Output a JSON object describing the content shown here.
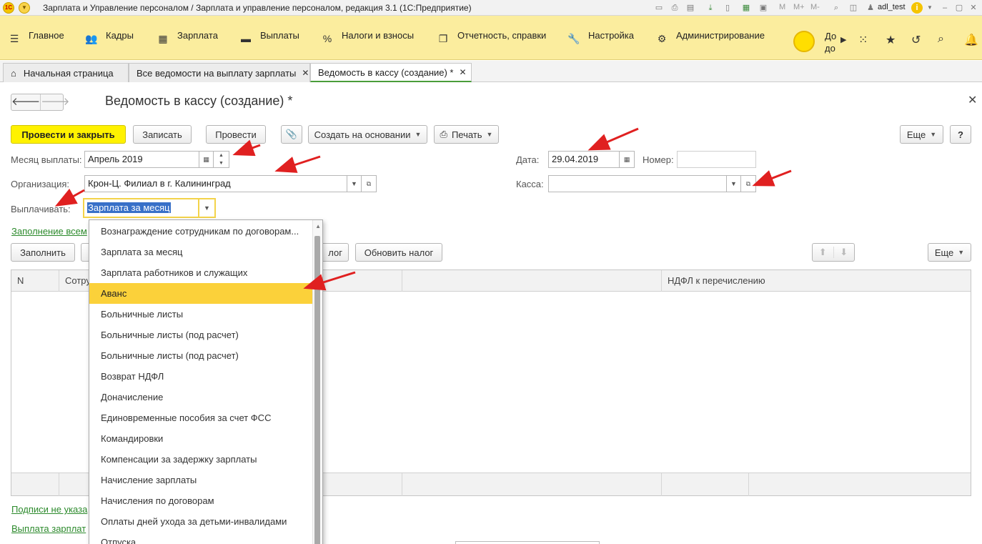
{
  "window": {
    "title": "Зарплата и Управление персоналом / Зарплата и управление персоналом, редакция 3.1  (1С:Предприятие)",
    "user": "adl_test",
    "m_buttons": [
      "M",
      "M+",
      "M-"
    ]
  },
  "menu": {
    "items": [
      {
        "label": "Главное",
        "icon": "hamburger-icon"
      },
      {
        "label": "Кадры",
        "icon": "people-icon"
      },
      {
        "label": "Зарплата",
        "icon": "calculator-icon"
      },
      {
        "label": "Выплаты",
        "icon": "wallet-icon"
      },
      {
        "label": "Налоги и взносы",
        "icon": "percent-icon"
      },
      {
        "label": "Отчетность, справки",
        "icon": "reports-icon"
      },
      {
        "label": "Настройка",
        "icon": "wrench-icon"
      },
      {
        "label": "Администрирование",
        "icon": "gear-icon"
      }
    ],
    "truncated_top": "До",
    "truncated_bottom": "до"
  },
  "tabs": [
    {
      "label": "Начальная страница"
    },
    {
      "label": "Все ведомости на выплату зарплаты"
    },
    {
      "label": "Ведомость в кассу (создание) *"
    }
  ],
  "form": {
    "title": "Ведомость в кассу (создание) *",
    "buttons": {
      "post_close": "Провести и закрыть",
      "save": "Записать",
      "post": "Провести",
      "create_based": "Создать на основании",
      "print": "Печать",
      "more": "Еще",
      "help": "?"
    },
    "month_label": "Месяц выплаты:",
    "month_value": "Апрель 2019",
    "date_label": "Дата:",
    "date_value": "29.04.2019",
    "number_label": "Номер:",
    "number_value": "",
    "org_label": "Организация:",
    "org_value": "Крон-Ц. Филиал в г. Калининград",
    "cash_label": "Касса:",
    "cash_value": "",
    "pay_label": "Выплачивать:",
    "pay_value": "Зарплата за месяц",
    "fill_link": "Заполнение всем",
    "fill_btn": "Заполнить",
    "tax_btn_partial": "лог",
    "update_tax_btn": "Обновить налог",
    "more2": "Еще",
    "signatures_link": "Подписи не указа",
    "payout_link": "Выплата зарплат"
  },
  "table": {
    "columns": [
      "N",
      "Сотру",
      "",
      "НДФЛ к перечислению"
    ]
  },
  "dropdown": {
    "items": [
      "Вознаграждение сотрудникам по договорам...",
      "Зарплата за месяц",
      "Зарплата работников и служащих",
      "Аванс",
      "Больничные листы",
      "Больничные листы (под расчет)",
      "Больничные листы (под расчет)",
      "Возврат НДФЛ",
      "Доначисление",
      "Единовременные пособия за счет ФСС",
      "Командировки",
      "Компенсации за задержку зарплаты",
      "Начисление зарплаты",
      "Начисления по договорам",
      "Оплаты дней ухода за детьми-инвалидами",
      "Отпуска"
    ],
    "highlighted": "Аванс"
  },
  "colors": {
    "menu_bg": "#fbed9e",
    "primary_button": "#fff200",
    "highlight": "#fbd13a",
    "link": "#2c8a2c",
    "annotation_arrow": "#e02020"
  }
}
